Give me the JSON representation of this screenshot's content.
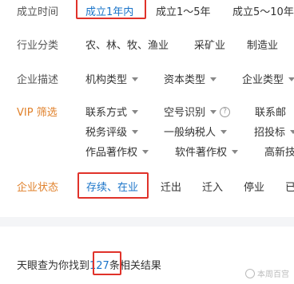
{
  "filters": {
    "established": {
      "label": "成立时间",
      "options": [
        "成立1年内",
        "成立1～5年",
        "成立5～10年"
      ]
    },
    "industry": {
      "label": "行业分类",
      "options": [
        "农、林、牧、渔业",
        "采矿业",
        "制造业"
      ]
    },
    "description": {
      "label": "企业描述",
      "options": [
        "机构类型",
        "资本类型",
        "企业类型"
      ]
    },
    "vip": {
      "label": "VIP 筛选",
      "row1": [
        "联系方式",
        "空号识别",
        "联系邮"
      ],
      "row2": [
        "税务评级",
        "一般纳税人",
        "招投标"
      ],
      "row3": [
        "作品著作权",
        "软件著作权",
        "高新技"
      ]
    },
    "status": {
      "label": "企业状态",
      "options": [
        "存续、在业",
        "迁出",
        "迁入",
        "停业",
        "已"
      ]
    }
  },
  "result": {
    "prefix": "天眼查为你找到",
    "count": "127",
    "suffix": "条相关结果"
  },
  "watermark": "本周百宫",
  "colors": {
    "accent": "#1a74c9",
    "highlight_box": "#e0322a",
    "vip_label": "#e0802a"
  }
}
